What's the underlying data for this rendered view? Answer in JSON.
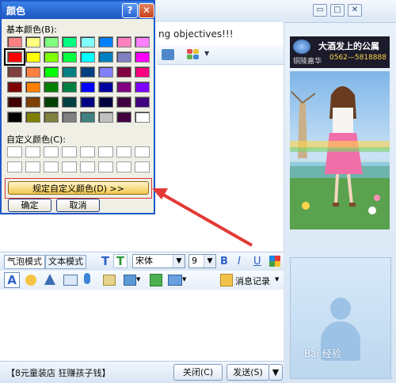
{
  "chat": {
    "objective_text": "ng objectives!!!",
    "ad": {
      "title": "大酒发上的公属",
      "phone": "0562—5818888",
      "brand": "铜陵嘉华"
    },
    "modes": [
      "气泡模式",
      "文本模式"
    ],
    "font_name": "宋体",
    "font_size": "9",
    "format_labels": [
      "B",
      "I",
      "U"
    ],
    "message_log_label": "消息记录",
    "ad_text": "【8元童装店 狂赚孩子钱】",
    "close_label": "关闭(C)",
    "send_label": "发送(S)",
    "watermark": "Bai 经验"
  },
  "dialog": {
    "title": "颜色",
    "help": "?",
    "close": "✕",
    "basic_label": "基本颜色(B):",
    "custom_label": "自定义颜色(C):",
    "define_label": "规定自定义颜色(D) >>",
    "ok_label": "确定",
    "cancel_label": "取消",
    "basic_colors": [
      [
        "#ff8080",
        "#ffff80",
        "#80ff80",
        "#00ff80",
        "#80ffff",
        "#0080ff",
        "#ff80c0",
        "#ff80ff"
      ],
      [
        "#ff0000",
        "#ffff00",
        "#80ff00",
        "#00ff40",
        "#00ffff",
        "#0080c0",
        "#8080c0",
        "#ff00ff"
      ],
      [
        "#804040",
        "#ff8040",
        "#00ff00",
        "#008080",
        "#004080",
        "#8080ff",
        "#800040",
        "#ff0080"
      ],
      [
        "#800000",
        "#ff8000",
        "#008000",
        "#008040",
        "#0000ff",
        "#0000a0",
        "#800080",
        "#8000ff"
      ],
      [
        "#400000",
        "#804000",
        "#004000",
        "#004040",
        "#000080",
        "#000040",
        "#400040",
        "#400080"
      ],
      [
        "#000000",
        "#808000",
        "#808040",
        "#808080",
        "#408080",
        "#c0c0c0",
        "#400040",
        "#ffffff"
      ]
    ],
    "selected": "#ff0000"
  },
  "colors": {
    "title_bar": "#1c56c2",
    "define_button": "#f2c74d",
    "annotation": "#e53935"
  }
}
